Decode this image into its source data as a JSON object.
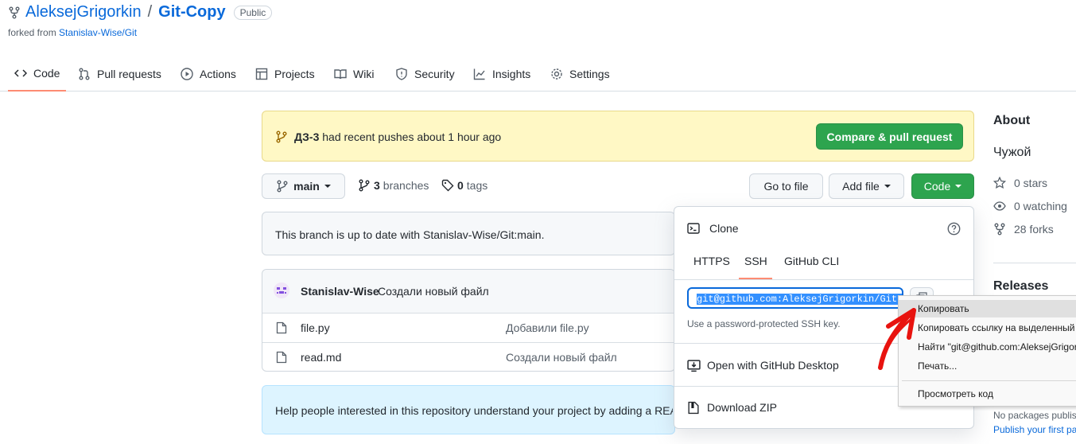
{
  "repo": {
    "owner": "AleksejGrigorkin",
    "separator": "/",
    "name": "Git-Copy",
    "visibility": "Public",
    "forked_prefix": "forked from ",
    "forked_source": "Stanislav-Wise/Git"
  },
  "tabs": [
    {
      "label": "Code",
      "icon": "code-icon"
    },
    {
      "label": "Pull requests",
      "icon": "pull-request-icon"
    },
    {
      "label": "Actions",
      "icon": "play-icon"
    },
    {
      "label": "Projects",
      "icon": "table-icon"
    },
    {
      "label": "Wiki",
      "icon": "book-icon"
    },
    {
      "label": "Security",
      "icon": "shield-icon"
    },
    {
      "label": "Insights",
      "icon": "graph-icon"
    },
    {
      "label": "Settings",
      "icon": "gear-icon"
    }
  ],
  "banner": {
    "branch": "ДЗ-3",
    "text": " had recent pushes about 1 hour ago",
    "button": "Compare & pull request"
  },
  "toolbar": {
    "branch": "main",
    "branches_count": "3",
    "branches_label": " branches",
    "tags_count": "0",
    "tags_label": " tags",
    "go_to_file": "Go to file",
    "add_file": "Add file",
    "code": "Code"
  },
  "status": "This branch is up to date with Stanislav-Wise/Git:main.",
  "commit": {
    "author": "Stanislav-Wise",
    "message": "Создали новый файл"
  },
  "files": [
    {
      "name": "file.py",
      "message": "Добавили file.py"
    },
    {
      "name": "read.md",
      "message": "Создали новый файл"
    }
  ],
  "readme_hint": "Help people interested in this repository understand your project by adding a REA",
  "clone": {
    "title": "Clone",
    "tabs": [
      "HTTPS",
      "SSH",
      "GitHub CLI"
    ],
    "active_tab": "SSH",
    "url": "git@github.com:AleksejGrigorkin/Git-Copy.git",
    "hint": "Use a password-protected SSH key.",
    "open_desktop": "Open with GitHub Desktop",
    "download_zip": "Download ZIP"
  },
  "context_menu": {
    "items": [
      "Копировать",
      "Копировать ссылку на выделенный т",
      "Найти \"git@github.com:AleksejGrigor",
      "Печать...",
      "Просмотреть код"
    ]
  },
  "sidebar": {
    "about_title": "About",
    "description": "Чужой",
    "stars": "0 stars",
    "watching": "0 watching",
    "forks": "28 forks",
    "releases_title": "Releases",
    "no_packages": "No packages publis",
    "publish_link": "Publish your first pa"
  },
  "colors": {
    "accent": "#0969da",
    "green": "#2da44e",
    "banner_bg": "#fff8c5",
    "annotation_arrow": "#e8130f"
  }
}
